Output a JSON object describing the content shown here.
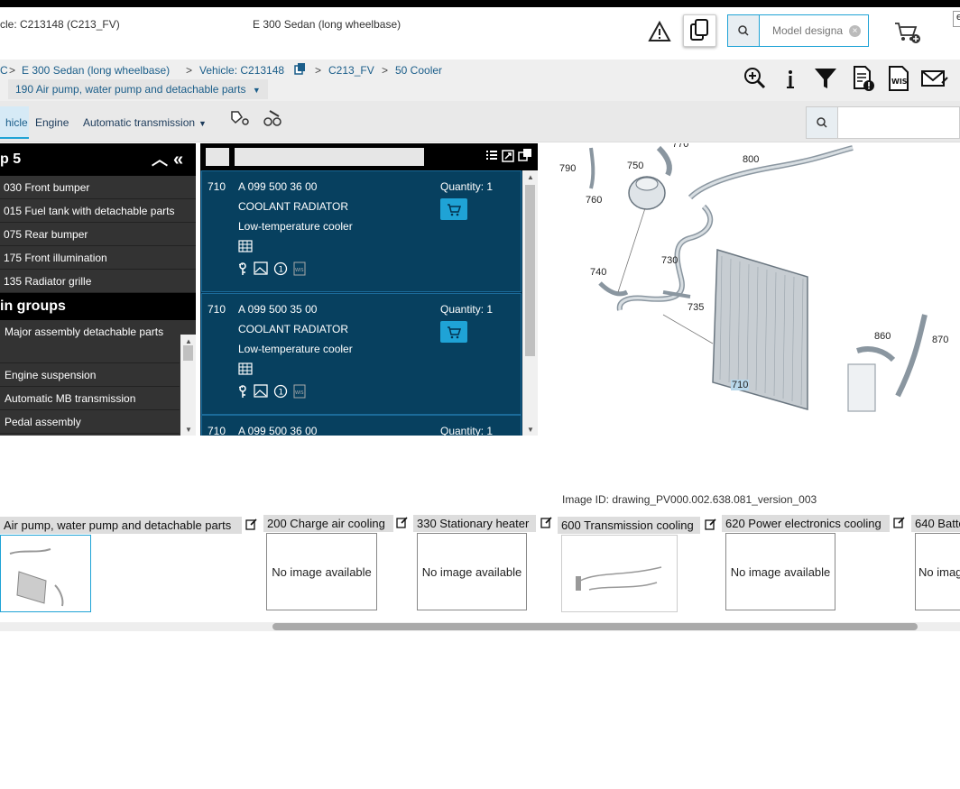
{
  "header": {
    "vehicle_text": "cle: C213148 (C213_FV)",
    "model_text": "E 300 Sedan (long wheelbase)",
    "model_search_placeholder": "Model designa",
    "corner_text": "e"
  },
  "breadcrumb": {
    "items": [
      "C",
      "E 300 Sedan (long wheelbase)",
      "Vehicle: C213148",
      "C213_FV",
      "50 Cooler"
    ],
    "separator": ">",
    "group_dropdown": "190 Air pump, water pump and detachable parts"
  },
  "tabs": [
    "hicle",
    "Engine",
    "Automatic transmission"
  ],
  "left_panel": {
    "top_header": "p 5",
    "top_items": [
      "030 Front bumper",
      "015 Fuel tank with detachable parts",
      "075 Rear bumper",
      "175 Front illumination",
      "135 Radiator grille"
    ],
    "groups_header": "in groups",
    "group_items": [
      "Major assembly detachable parts",
      "Engine suspension",
      "Automatic MB transmission",
      "Pedal assembly"
    ]
  },
  "parts": [
    {
      "pos": "710",
      "number": "A 099 500 36 00",
      "name": "COOLANT RADIATOR",
      "desc": "Low-temperature cooler",
      "qty": "Quantity: 1",
      "table": "..."
    },
    {
      "pos": "710",
      "number": "A 099 500 35 00",
      "name": "COOLANT RADIATOR",
      "desc": "Low-temperature cooler",
      "qty": "Quantity: 1",
      "table": "..."
    },
    {
      "pos": "710",
      "number": "A 099 500 36 00",
      "qty": "Quantity: 1"
    }
  ],
  "drawing": {
    "callouts": [
      "770",
      "790",
      "750",
      "800",
      "760",
      "740",
      "730",
      "735",
      "860",
      "870",
      "710"
    ]
  },
  "image_id": "Image ID: drawing_PV000.002.638.081_version_003",
  "thumbnails": [
    {
      "label": "Air pump, water pump and detachable parts"
    },
    {
      "label": "200 Charge air cooling",
      "body": "No image available"
    },
    {
      "label": "330 Stationary heater",
      "body": "No image available"
    },
    {
      "label": "600 Transmission cooling"
    },
    {
      "label": "620 Power electronics cooling",
      "body": "No image available"
    },
    {
      "label": "640 Batte",
      "body": "No imag"
    }
  ],
  "colors": {
    "accent": "#1fa3d6",
    "parts_bg": "#07405f",
    "panel_dark": "#333333"
  }
}
